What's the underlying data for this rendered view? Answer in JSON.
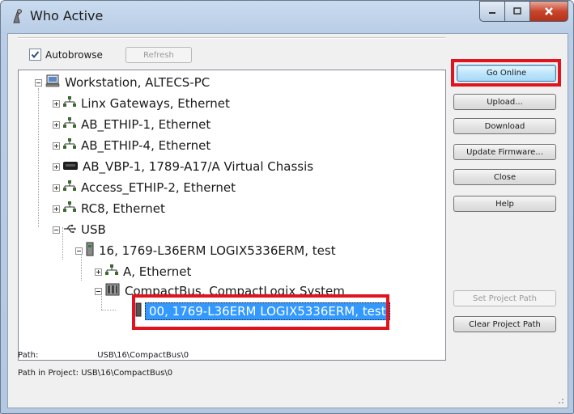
{
  "window": {
    "title": "Who Active"
  },
  "autobrowse": {
    "label": "Autobrowse",
    "checked": true
  },
  "refresh_label": "Refresh",
  "tree": {
    "root": "Workstation, ALTECS-PC",
    "items": [
      "Linx Gateways, Ethernet",
      "AB_ETHIP-1, Ethernet",
      "AB_ETHIP-4, Ethernet",
      "AB_VBP-1, 1789-A17/A Virtual Chassis",
      "Access_ETHIP-2, Ethernet",
      "RC8, Ethernet",
      "USB"
    ],
    "usb_device": "16, 1769-L36ERM LOGIX5336ERM, test",
    "device_children": [
      "A, Ethernet",
      "CompactBus, CompactLogix System"
    ],
    "selected": "00, 1769-L36ERM LOGIX5336ERM, test"
  },
  "buttons": {
    "go_online": "Go Online",
    "upload": "Upload...",
    "download": "Download",
    "update_firmware": "Update Firmware...",
    "close": "Close",
    "help": "Help",
    "set_project_path": "Set Project Path",
    "clear_project_path": "Clear Project Path"
  },
  "path": {
    "path_label": "Path:",
    "path_value": "USB\\16\\CompactBus\\0",
    "project_label": "Path in Project:",
    "project_value": "USB\\16\\CompactBus\\0"
  },
  "colors": {
    "highlight": "#e0141e",
    "selection": "#3399ff"
  }
}
